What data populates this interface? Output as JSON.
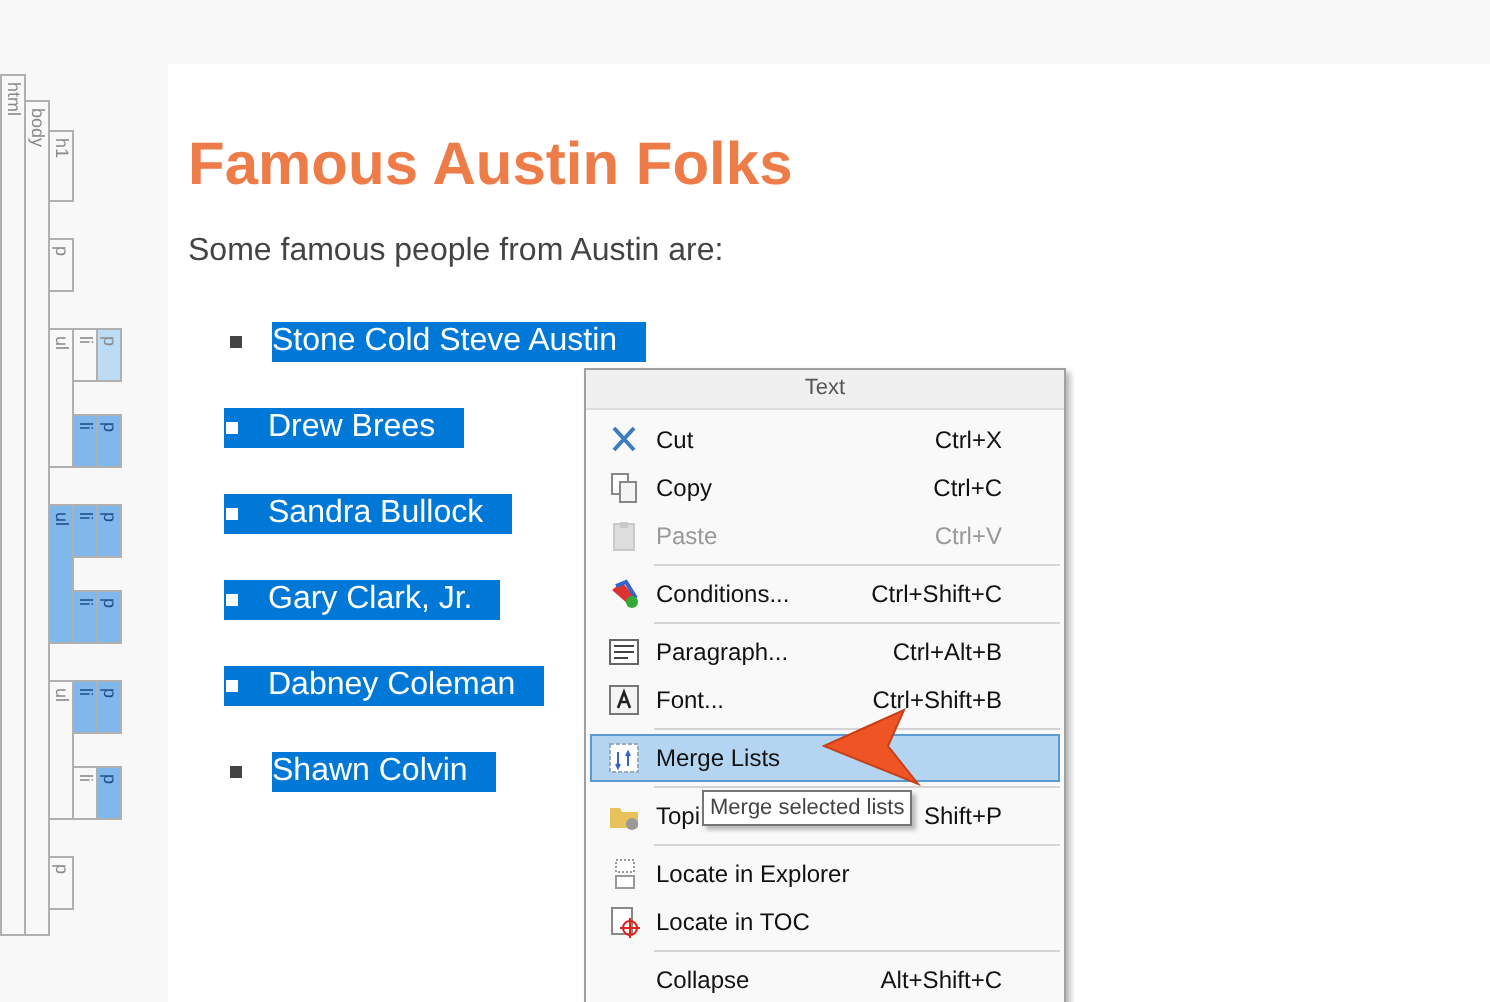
{
  "tag_tree": {
    "label": "html",
    "selected": false,
    "partial": false,
    "children": [
      {
        "label": "body",
        "selected": false,
        "partial": false,
        "children": [
          {
            "label": "h1",
            "selected": false,
            "partial": false
          },
          {
            "label": "p",
            "selected": false,
            "partial": false
          },
          {
            "label": "ul",
            "selected": false,
            "partial": false,
            "children": [
              {
                "label": "li",
                "selected": false,
                "partial": false,
                "children": [
                  {
                    "label": "p",
                    "selected": false,
                    "partial": true
                  }
                ]
              },
              {
                "label": "li",
                "selected": true,
                "partial": false,
                "children": [
                  {
                    "label": "p",
                    "selected": true,
                    "partial": false
                  }
                ]
              }
            ]
          },
          {
            "label": "ul",
            "selected": true,
            "partial": false,
            "children": [
              {
                "label": "li",
                "selected": true,
                "partial": false,
                "children": [
                  {
                    "label": "p",
                    "selected": true,
                    "partial": false
                  }
                ]
              },
              {
                "label": "li",
                "selected": true,
                "partial": false,
                "children": [
                  {
                    "label": "p",
                    "selected": true,
                    "partial": false
                  }
                ]
              }
            ]
          },
          {
            "label": "ul",
            "selected": false,
            "partial": false,
            "children": [
              {
                "label": "li",
                "selected": true,
                "partial": false,
                "children": [
                  {
                    "label": "p",
                    "selected": true,
                    "partial": false
                  }
                ]
              },
              {
                "label": "li",
                "selected": false,
                "partial": false,
                "children": [
                  {
                    "label": "p",
                    "selected": true,
                    "partial": false
                  }
                ]
              }
            ]
          },
          {
            "label": "p",
            "selected": false,
            "partial": false
          }
        ]
      }
    ]
  },
  "document": {
    "heading": "Famous Austin Folks",
    "intro": "Some famous people from Austin are:",
    "list_items": [
      {
        "text": "Stone Cold Steve Austin",
        "selected": true,
        "marker_selected": false
      },
      {
        "text": "Drew Brees",
        "selected": true,
        "marker_selected": true
      },
      {
        "text": "Sandra Bullock",
        "selected": true,
        "marker_selected": true
      },
      {
        "text": "Gary Clark, Jr.",
        "selected": true,
        "marker_selected": true
      },
      {
        "text": "Dabney Coleman",
        "selected": true,
        "marker_selected": true
      },
      {
        "text": "Shawn Colvin",
        "selected": true,
        "marker_selected": false
      }
    ]
  },
  "context_menu": {
    "title": "Text",
    "items": [
      {
        "kind": "item",
        "label": "Cut",
        "shortcut": "Ctrl+X",
        "disabled": false,
        "selected": false
      },
      {
        "kind": "item",
        "label": "Copy",
        "shortcut": "Ctrl+C",
        "disabled": false,
        "selected": false
      },
      {
        "kind": "item",
        "label": "Paste",
        "shortcut": "Ctrl+V",
        "disabled": true,
        "selected": false
      },
      {
        "kind": "separator"
      },
      {
        "kind": "item",
        "label": "Conditions...",
        "shortcut": "Ctrl+Shift+C",
        "disabled": false,
        "selected": false
      },
      {
        "kind": "separator"
      },
      {
        "kind": "item",
        "label": "Paragraph...",
        "shortcut": "Ctrl+Alt+B",
        "disabled": false,
        "selected": false
      },
      {
        "kind": "item",
        "label": "Font...",
        "shortcut": "Ctrl+Shift+B",
        "disabled": false,
        "selected": false
      },
      {
        "kind": "separator"
      },
      {
        "kind": "item",
        "label": "Merge Lists",
        "disabled": false,
        "selected": true
      },
      {
        "kind": "separator"
      },
      {
        "kind": "item",
        "label": "Topi",
        "shortcut": "Shift+P",
        "disabled": false,
        "selected": false
      },
      {
        "kind": "separator"
      },
      {
        "kind": "item",
        "label": "Locate in Explorer",
        "disabled": false,
        "selected": false
      },
      {
        "kind": "item",
        "label": "Locate in TOC",
        "disabled": false,
        "selected": false
      },
      {
        "kind": "separator"
      },
      {
        "kind": "item",
        "label": "Collapse",
        "shortcut": "Alt+Shift+C",
        "disabled": false,
        "selected": false
      }
    ]
  },
  "tooltip": "Merge selected lists"
}
